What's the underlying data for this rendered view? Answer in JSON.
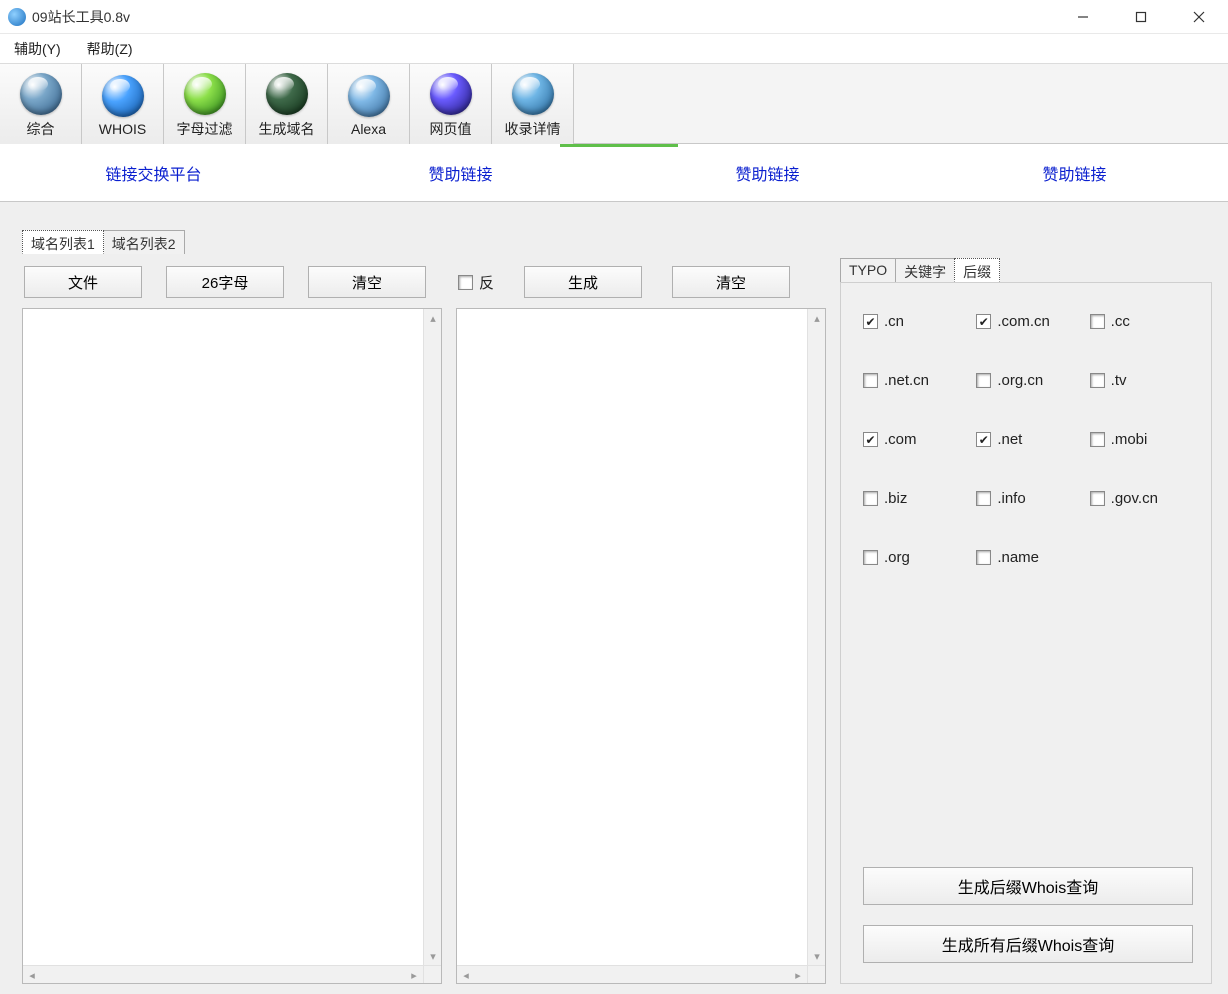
{
  "window": {
    "title": "09站长工具0.8v"
  },
  "menu": {
    "assist": "辅助(Y)",
    "help": "帮助(Z)"
  },
  "toolbar": {
    "items": [
      {
        "label": "综合"
      },
      {
        "label": "WHOIS"
      },
      {
        "label": "字母过滤"
      },
      {
        "label": "生成域名"
      },
      {
        "label": "Alexa"
      },
      {
        "label": "网页值"
      },
      {
        "label": "收录详情"
      }
    ]
  },
  "linkbar": {
    "exchange": "链接交换平台",
    "sponsor1": "赞助链接",
    "sponsor2": "赞助链接",
    "sponsor3": "赞助链接"
  },
  "left": {
    "tab1": "域名列表1",
    "tab2": "域名列表2",
    "file_btn": "文件",
    "alpha_btn": "26字母",
    "clear_btn": "清空"
  },
  "mid": {
    "reverse_label": "反",
    "gen_btn": "生成",
    "clear_btn": "清空"
  },
  "right": {
    "tab_typo": "TYPO",
    "tab_keyword": "关键字",
    "tab_suffix": "后缀",
    "suffixes": {
      "cn": {
        "label": ".cn",
        "checked": true
      },
      "comcn": {
        "label": ".com.cn",
        "checked": true
      },
      "cc": {
        "label": ".cc",
        "checked": false
      },
      "netcn": {
        "label": ".net.cn",
        "checked": false
      },
      "orgcn": {
        "label": ".org.cn",
        "checked": false
      },
      "tv": {
        "label": ".tv",
        "checked": false
      },
      "com": {
        "label": ".com",
        "checked": true
      },
      "net": {
        "label": ".net",
        "checked": true
      },
      "mobi": {
        "label": ".mobi",
        "checked": false
      },
      "biz": {
        "label": ".biz",
        "checked": false
      },
      "info": {
        "label": ".info",
        "checked": false
      },
      "govcn": {
        "label": ".gov.cn",
        "checked": false
      },
      "org": {
        "label": ".org",
        "checked": false
      },
      "name": {
        "label": ".name",
        "checked": false
      }
    },
    "gen_suffix_btn": "生成后缀Whois查询",
    "gen_all_suffix_btn": "生成所有后缀Whois查询"
  }
}
